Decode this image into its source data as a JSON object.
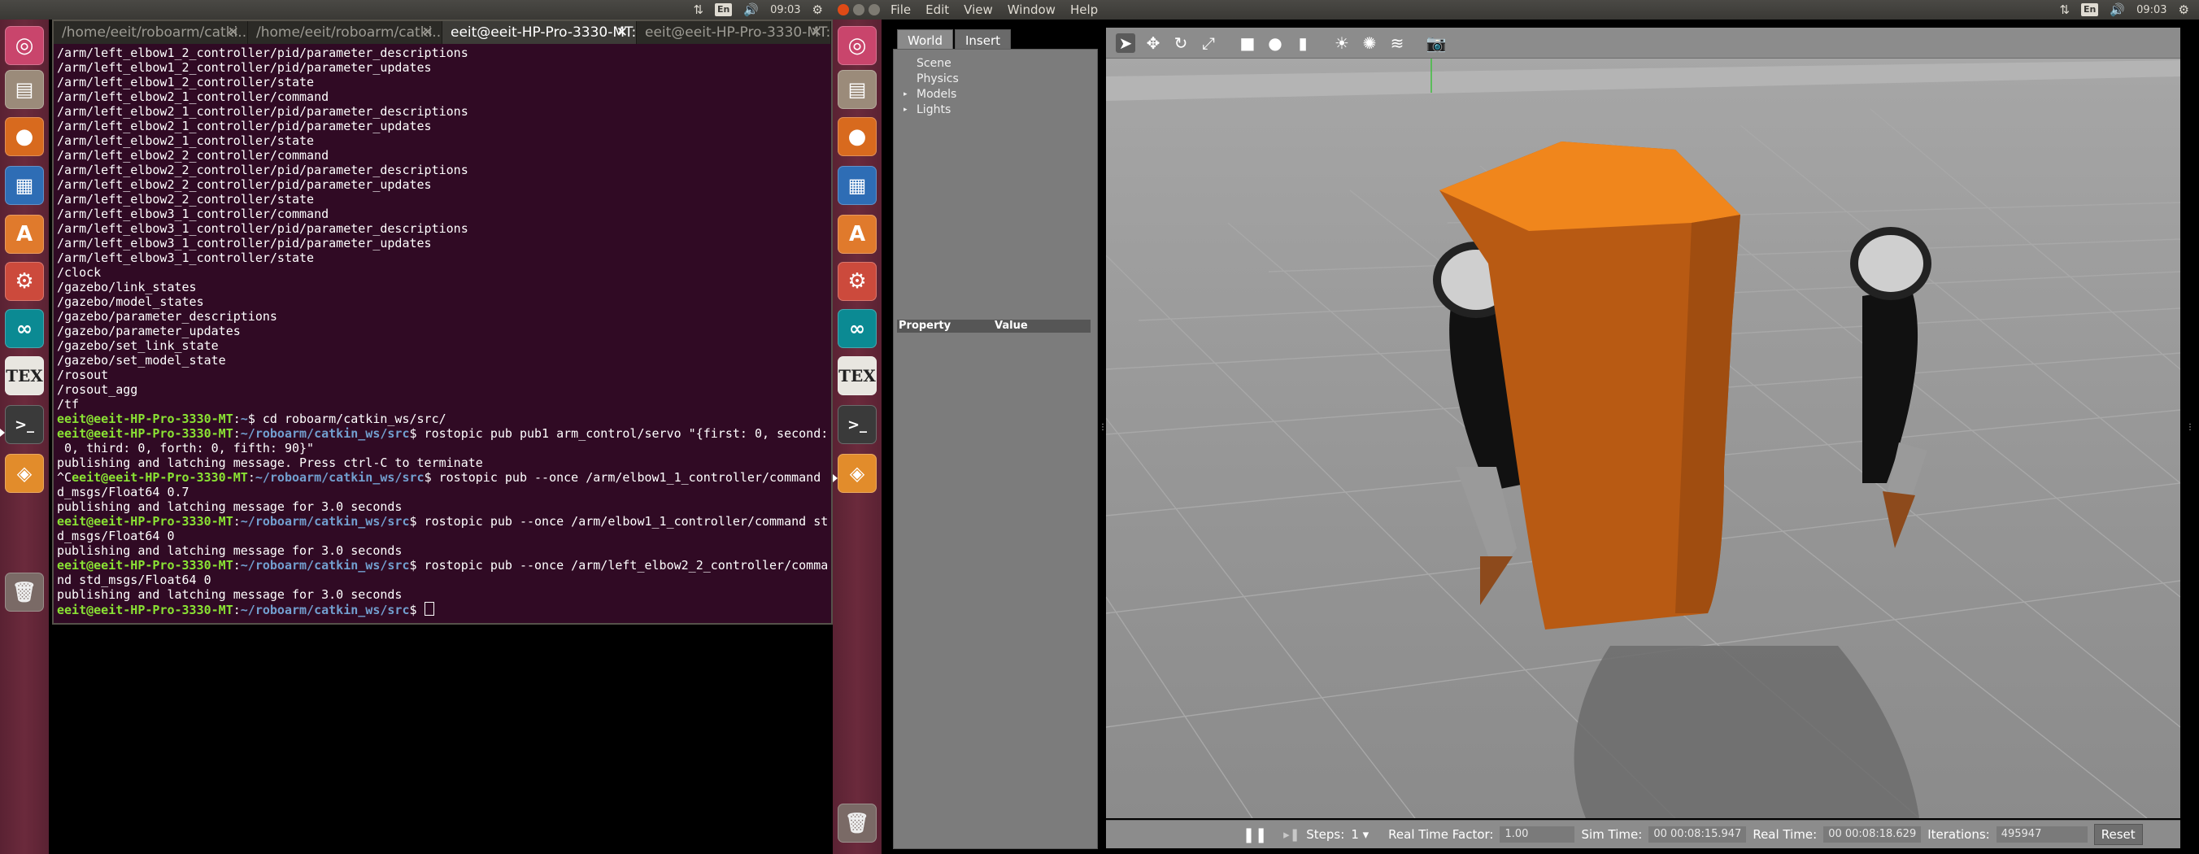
{
  "system_tray_left": {
    "keyboard": "En",
    "time": "09:03"
  },
  "system_tray_right": {
    "keyboard": "En",
    "time": "09:03"
  },
  "launcher_icons": [
    "ubuntu-dash-icon",
    "files-icon",
    "firefox-icon",
    "writer-icon",
    "software-center-icon",
    "settings-icon",
    "arduino-icon",
    "tex-icon",
    "terminal-icon",
    "gazebo-icon",
    "trash-icon"
  ],
  "terminal": {
    "tabs": [
      {
        "label": "/home/eeit/roboarm/catki..."
      },
      {
        "label": "/home/eeit/roboarm/catki..."
      },
      {
        "label": "eeit@eeit-HP-Pro-3330-MT: ..."
      },
      {
        "label": "eeit@eeit-HP-Pro-3330-MT: ..."
      }
    ],
    "lines": [
      {
        "text": "/arm/left_elbow1_2_controller/pid/parameter_descriptions"
      },
      {
        "text": "/arm/left_elbow1_2_controller/pid/parameter_updates"
      },
      {
        "text": "/arm/left_elbow1_2_controller/state"
      },
      {
        "text": "/arm/left_elbow2_1_controller/command"
      },
      {
        "text": "/arm/left_elbow2_1_controller/pid/parameter_descriptions"
      },
      {
        "text": "/arm/left_elbow2_1_controller/pid/parameter_updates"
      },
      {
        "text": "/arm/left_elbow2_1_controller/state"
      },
      {
        "text": "/arm/left_elbow2_2_controller/command"
      },
      {
        "text": "/arm/left_elbow2_2_controller/pid/parameter_descriptions"
      },
      {
        "text": "/arm/left_elbow2_2_controller/pid/parameter_updates"
      },
      {
        "text": "/arm/left_elbow2_2_controller/state"
      },
      {
        "text": "/arm/left_elbow3_1_controller/command"
      },
      {
        "text": "/arm/left_elbow3_1_controller/pid/parameter_descriptions"
      },
      {
        "text": "/arm/left_elbow3_1_controller/pid/parameter_updates"
      },
      {
        "text": "/arm/left_elbow3_1_controller/state"
      },
      {
        "text": "/clock"
      },
      {
        "text": "/gazebo/link_states"
      },
      {
        "text": "/gazebo/model_states"
      },
      {
        "text": "/gazebo/parameter_descriptions"
      },
      {
        "text": "/gazebo/parameter_updates"
      },
      {
        "text": "/gazebo/set_link_state"
      },
      {
        "text": "/gazebo/set_model_state"
      },
      {
        "text": "/rosout"
      },
      {
        "text": "/rosout_agg"
      },
      {
        "text": "/tf"
      },
      {
        "user": "eeit@eeit-HP-Pro-3330-MT",
        "path": "~",
        "cmd": "$ cd roboarm/catkin_ws/src/"
      },
      {
        "user": "eeit@eeit-HP-Pro-3330-MT",
        "path": "~/roboarm/catkin_ws/src",
        "cmd": "$ rostopic pub pub1 arm_control/servo \"{first: 0, second:"
      },
      {
        "text": " 0, third: 0, forth: 0, fifth: 90}\""
      },
      {
        "text": "publishing and latching message. Press ctrl-C to terminate"
      },
      {
        "pre": "^C",
        "user": "eeit@eeit-HP-Pro-3330-MT",
        "path": "~/roboarm/catkin_ws/src",
        "cmd": "$ rostopic pub --once /arm/elbow1_1_controller/command"
      },
      {
        "text": "d_msgs/Float64 0.7"
      },
      {
        "text": "publishing and latching message for 3.0 seconds"
      },
      {
        "user": "eeit@eeit-HP-Pro-3330-MT",
        "path": "~/roboarm/catkin_ws/src",
        "cmd": "$ rostopic pub --once /arm/elbow1_1_controller/command st"
      },
      {
        "text": "d_msgs/Float64 0"
      },
      {
        "text": "publishing and latching message for 3.0 seconds"
      },
      {
        "user": "eeit@eeit-HP-Pro-3330-MT",
        "path": "~/roboarm/catkin_ws/src",
        "cmd": "$ rostopic pub --once /arm/left_elbow2_2_controller/comma"
      },
      {
        "text": "nd std_msgs/Float64 0"
      },
      {
        "text": "publishing and latching message for 3.0 seconds"
      },
      {
        "user": "eeit@eeit-HP-Pro-3330-MT",
        "path": "~/roboarm/catkin_ws/src",
        "cmd": "$ ",
        "cursor": true
      }
    ]
  },
  "gazebo": {
    "menu": [
      "File",
      "Edit",
      "View",
      "Window",
      "Help"
    ],
    "panel_tabs": [
      "World",
      "Insert"
    ],
    "tree": [
      "Scene",
      "Physics",
      "Models",
      "Lights"
    ],
    "property_header": {
      "property": "Property",
      "value": "Value"
    },
    "status": {
      "steps_label": "Steps:",
      "steps_value": "1",
      "rtf_label": "Real Time Factor:",
      "rtf_value": "1.00",
      "sim_time_label": "Sim Time:",
      "sim_time_value": "00 00:08:15.947",
      "real_time_label": "Real Time:",
      "real_time_value": "00 00:08:18.629",
      "iterations_label": "Iterations:",
      "iterations_value": "495947",
      "reset_label": "Reset"
    }
  }
}
